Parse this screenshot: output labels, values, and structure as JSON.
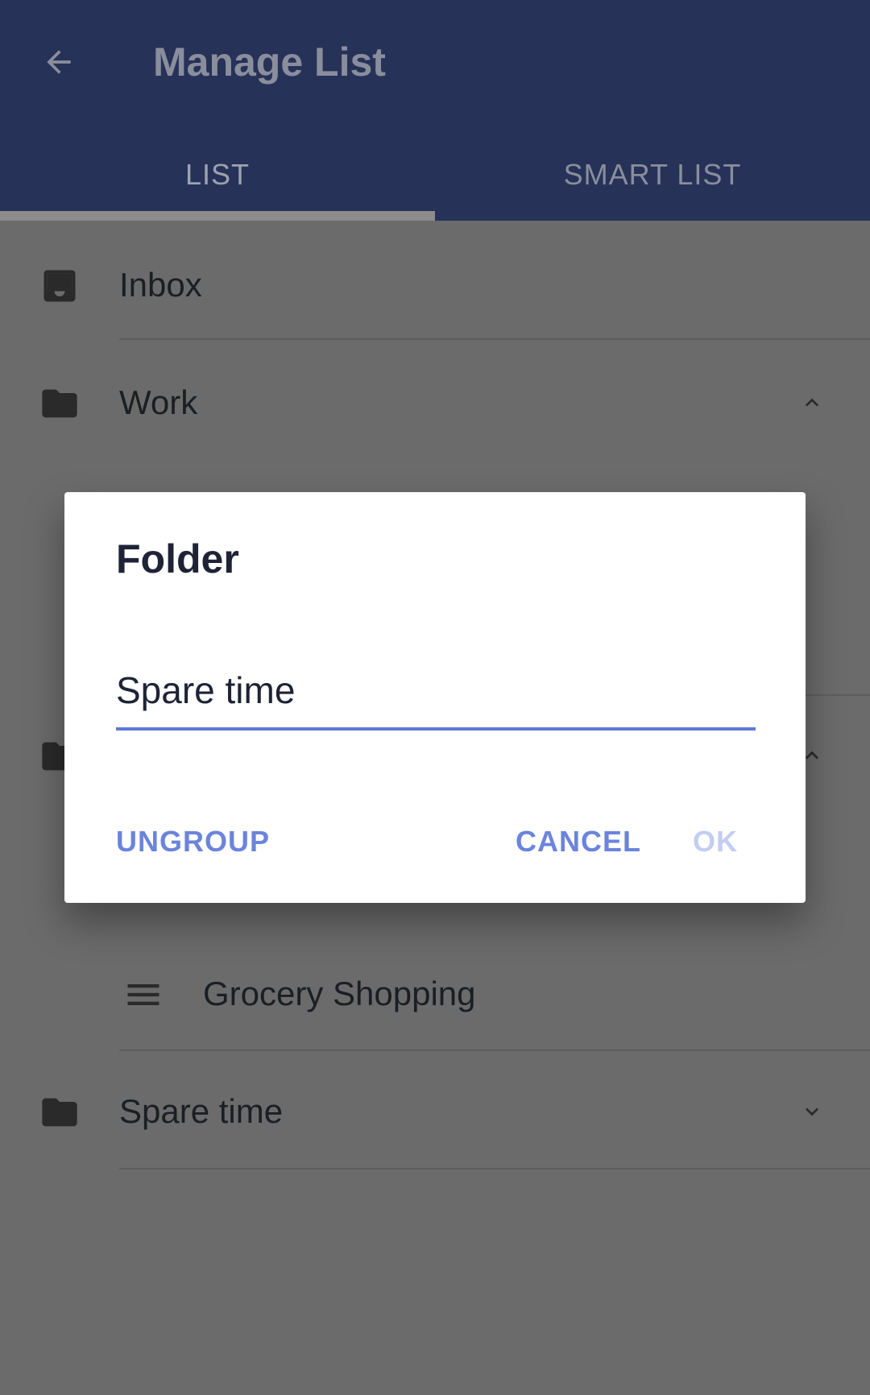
{
  "header": {
    "title": "Manage List",
    "back_icon": "arrow-left-icon"
  },
  "tabs": [
    {
      "label": "LIST",
      "active": true
    },
    {
      "label": "SMART LIST",
      "active": false
    }
  ],
  "list": {
    "inbox": {
      "label": "Inbox",
      "icon": "inbox-icon"
    },
    "work": {
      "label": "Work",
      "icon": "folder-icon",
      "expanded": true
    },
    "hidden_folder": {
      "icon": "folder-icon",
      "expanded": true
    },
    "grocery": {
      "label": "Grocery Shopping",
      "icon": "list-lines-icon"
    },
    "spare_time": {
      "label": "Spare time",
      "icon": "folder-icon",
      "expanded": false
    }
  },
  "dialog": {
    "title": "Folder",
    "input_value": "Spare time",
    "ungroup_label": "UNGROUP",
    "cancel_label": "CANCEL",
    "ok_label": "OK",
    "ok_enabled": false
  },
  "colors": {
    "appbar": "#273259",
    "accent": "#5f78d8",
    "scrim_background": "#6b6b6b"
  }
}
